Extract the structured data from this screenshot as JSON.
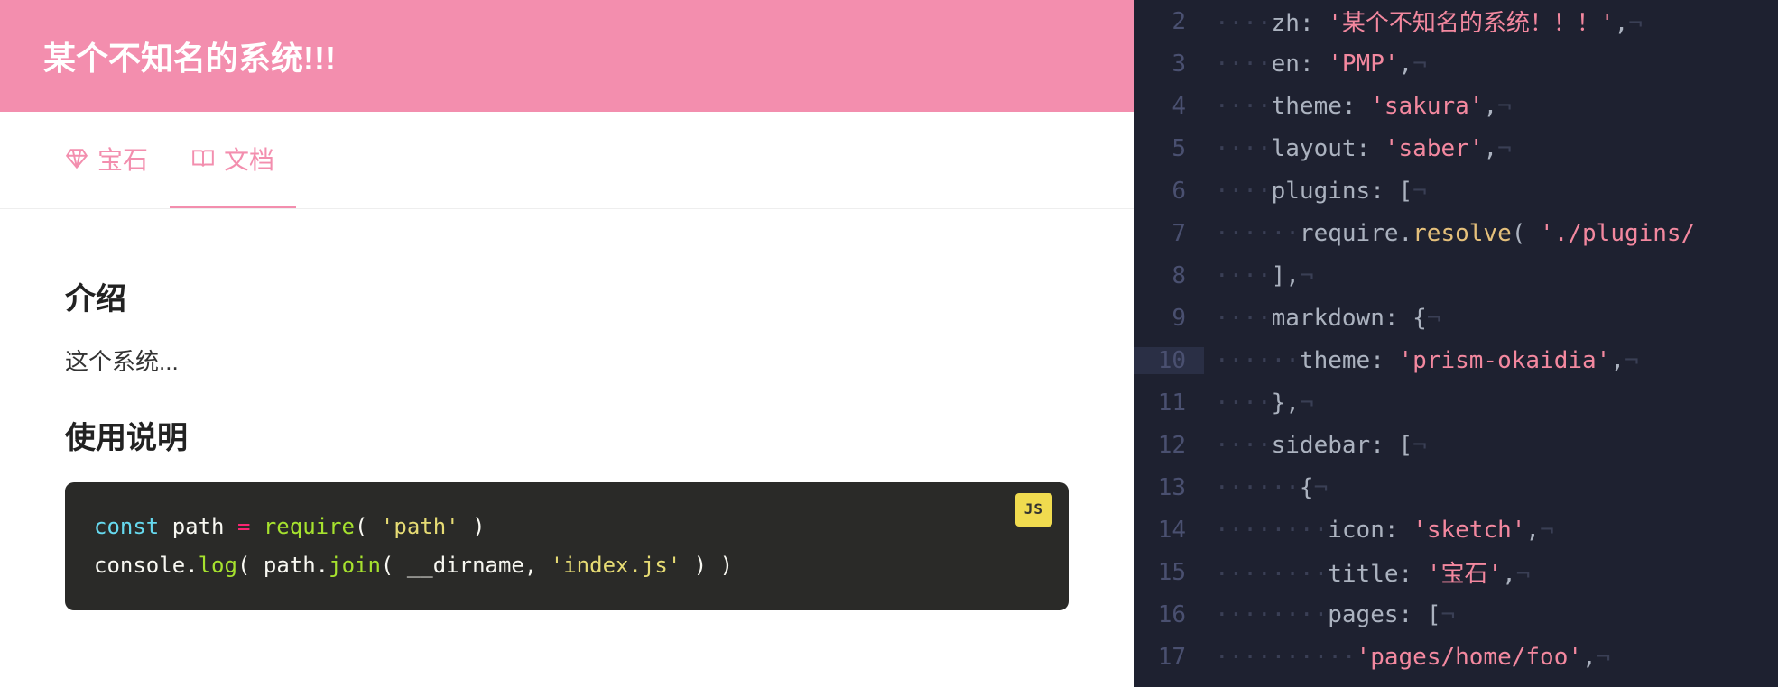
{
  "header": {
    "title": "某个不知名的系统!!!"
  },
  "tabs": [
    {
      "icon": "sketch-icon",
      "label": "宝石",
      "active": false
    },
    {
      "icon": "book-icon",
      "label": "文档",
      "active": true
    }
  ],
  "content": {
    "h1": "介绍",
    "p1": "这个系统...",
    "h2": "使用说明",
    "code_badge": "JS",
    "code": {
      "line1": {
        "kw": "const",
        "id": "path",
        "op": "=",
        "fn": "require",
        "str": "'path'"
      },
      "line2": {
        "obj": "console",
        "m1": "log",
        "obj2": "path",
        "m2": "join",
        "arg1": "__dirname",
        "str": "'index.js'"
      }
    }
  },
  "editor": {
    "lines": [
      {
        "n": "2",
        "ws": "····",
        "key": "zh",
        "punc1": ": ",
        "str": "'某个不知名的系统！！！'",
        "punc2": ",",
        "eol": "¬"
      },
      {
        "n": "3",
        "ws": "····",
        "key": "en",
        "punc1": ": ",
        "str": "'PMP'",
        "punc2": ",",
        "eol": "¬"
      },
      {
        "n": "4",
        "ws": "····",
        "key": "theme",
        "punc1": ": ",
        "str": "'sakura'",
        "punc2": ",",
        "eol": "¬"
      },
      {
        "n": "5",
        "ws": "····",
        "key": "layout",
        "punc1": ": ",
        "str": "'saber'",
        "punc2": ",",
        "eol": "¬"
      },
      {
        "n": "6",
        "ws": "····",
        "key": "plugins",
        "punc1": ": [",
        "eol": "¬"
      },
      {
        "n": "7",
        "ws": "······",
        "id": "require",
        "punc1": ".",
        "fn": "resolve",
        "punc2": "( ",
        "str": "'./plugins/",
        "eol": ""
      },
      {
        "n": "8",
        "ws": "····",
        "punc1": "],",
        "eol": "¬"
      },
      {
        "n": "9",
        "ws": "····",
        "key": "markdown",
        "punc1": ": {",
        "eol": "¬"
      },
      {
        "n": "10",
        "ws": "······",
        "key": "theme",
        "punc1": ": ",
        "str": "'prism-okaidia'",
        "punc2": ",",
        "eol": "¬",
        "current": true
      },
      {
        "n": "11",
        "ws": "····",
        "punc1": "},",
        "eol": "¬"
      },
      {
        "n": "12",
        "ws": "····",
        "key": "sidebar",
        "punc1": ": [",
        "eol": "¬"
      },
      {
        "n": "13",
        "ws": "······",
        "punc1": "{",
        "eol": "¬"
      },
      {
        "n": "14",
        "ws": "········",
        "key": "icon",
        "punc1": ": ",
        "str": "'sketch'",
        "punc2": ",",
        "eol": "¬"
      },
      {
        "n": "15",
        "ws": "········",
        "key": "title",
        "punc1": ": ",
        "str": "'宝石'",
        "punc2": ",",
        "eol": "¬"
      },
      {
        "n": "16",
        "ws": "········",
        "key": "pages",
        "punc1": ": [",
        "eol": "¬"
      },
      {
        "n": "17",
        "ws": "··········",
        "str": "'pages/home/foo'",
        "punc2": ",",
        "eol": "¬"
      }
    ]
  }
}
